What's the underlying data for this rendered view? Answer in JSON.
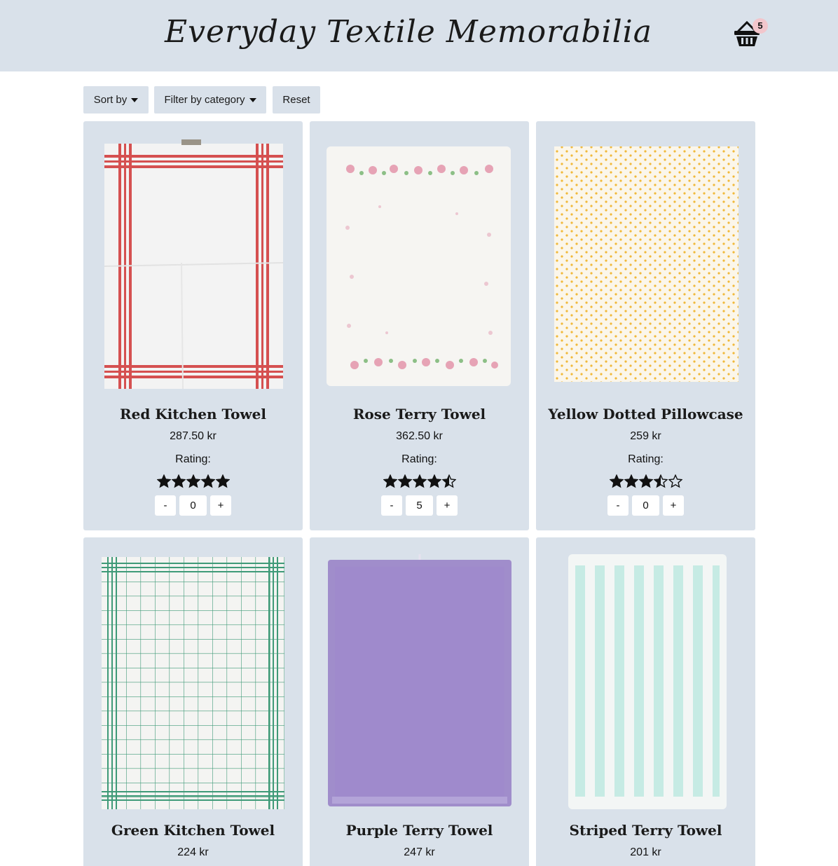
{
  "site": {
    "title": "Everyday Textile Memorabilia"
  },
  "cart": {
    "count": "5",
    "icon": "basket-icon"
  },
  "controls": {
    "sort_label": "Sort by",
    "filter_label": "Filter by category",
    "reset_label": "Reset"
  },
  "colors": {
    "header_bg": "#d9e1ea",
    "card_bg": "#d9e1ea",
    "badge": "#f2c6cc"
  },
  "products": [
    {
      "name": "Red Kitchen Towel",
      "price": "287.50 kr",
      "rating_label": "Rating:",
      "rating": 5,
      "qty": "0",
      "minus": "-",
      "plus": "+"
    },
    {
      "name": "Rose Terry Towel",
      "price": "362.50 kr",
      "rating_label": "Rating:",
      "rating": 4.5,
      "qty": "5",
      "minus": "-",
      "plus": "+"
    },
    {
      "name": "Yellow Dotted Pillowcase",
      "price": "259 kr",
      "rating_label": "Rating:",
      "rating": 3.5,
      "qty": "0",
      "minus": "-",
      "plus": "+"
    },
    {
      "name": "Green Kitchen Towel",
      "price": "224 kr"
    },
    {
      "name": "Purple Terry Towel",
      "price": "247 kr"
    },
    {
      "name": "Striped Terry Towel",
      "price": "201 kr"
    }
  ]
}
